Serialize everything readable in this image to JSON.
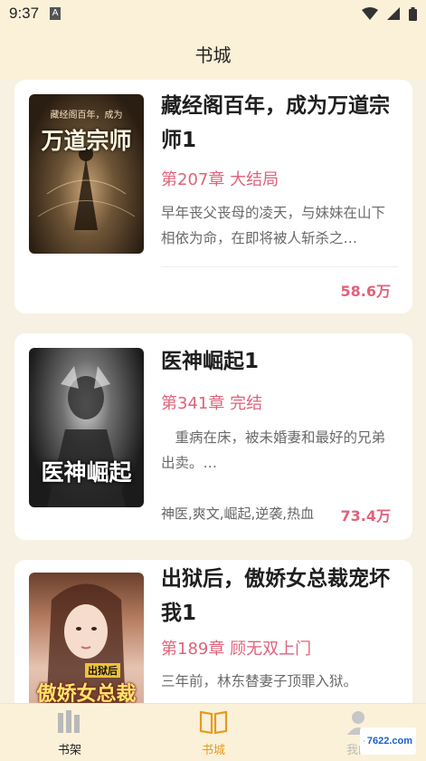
{
  "status_bar": {
    "time": "9:37",
    "icons": [
      "a-icon",
      "wifi-icon",
      "signal-icon",
      "battery-icon"
    ]
  },
  "header": {
    "title": "书城"
  },
  "books": [
    {
      "title": "藏经阁百年，成为万道宗师1",
      "chapter": "第207章 大结局",
      "intro": "早年丧父丧母的凌天，与妹妹在山下相依为命，在即将被人斩杀之…",
      "tags": "",
      "count": "58.6万",
      "cover_text": "万道宗师",
      "cover_sub": "藏经阁百年，成为"
    },
    {
      "title": "医神崛起1",
      "chapter": "第341章 完结",
      "intro": "　重病在床，被未婚妻和最好的兄弟出卖。…",
      "tags": "神医,爽文,崛起,逆袭,热血",
      "count": "73.4万",
      "cover_text": "医神崛起"
    },
    {
      "title": "出狱后，傲娇女总裁宠坏我1",
      "chapter": "第189章 顾无双上门",
      "intro": "三年前，林东替妻子顶罪入狱。",
      "tags": "",
      "count": "",
      "cover_text": "傲娇女总裁",
      "cover_sub": "出狱后"
    }
  ],
  "bottom_nav": {
    "shelf": "书架",
    "store": "书城",
    "mine": "我的"
  },
  "watermark": {
    "brand": "7622.com"
  },
  "colors": {
    "accent": "#e0627a",
    "active_tab": "#e59b1f",
    "header_bg": "#fbf1d9"
  }
}
